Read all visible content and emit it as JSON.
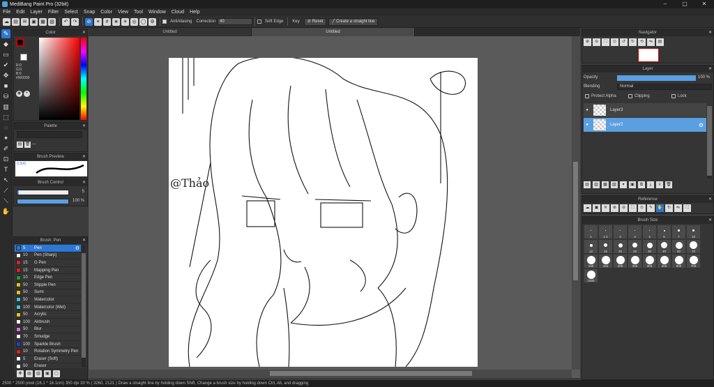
{
  "title": "MediBang Paint Pro (32bit)",
  "menu": [
    "File",
    "Edit",
    "Layer",
    "Filter",
    "Select",
    "Snap",
    "Color",
    "View",
    "Tool",
    "Window",
    "Cloud",
    "Help"
  ],
  "toolbar": {
    "antialias": "AntiAliasing",
    "correction_label": "Correction",
    "correction_value": "40",
    "soft_edge": "Soft Edge",
    "key": "Key",
    "reset": "Reset",
    "straight_line": "Create a straight line"
  },
  "tabs": [
    "Untitled",
    "Untitled"
  ],
  "color_panel": {
    "title": "Color",
    "r": "R:0",
    "g": "G:0",
    "b": "B:0",
    "hex": "#000000"
  },
  "palette_panel": {
    "title": "Palette",
    "dash": "---"
  },
  "brush_preview": {
    "title": "Brush Preview",
    "size": "0.3(4)"
  },
  "brush_control": {
    "title": "Brush Control",
    "size": "5",
    "opacity": "100 %",
    "opacity_fraction": 1.0
  },
  "brush_list": {
    "title": "Brush: Pen",
    "items": [
      {
        "size": "5",
        "name": "Pen",
        "color": "#2b78d6",
        "selected": true
      },
      {
        "size": "10",
        "name": "Pen (Sharp)",
        "color": "#ffffff"
      },
      {
        "size": "15",
        "name": "G Pen",
        "color": "#e02020"
      },
      {
        "size": "15",
        "name": "Mapping Pen",
        "color": "#e02020"
      },
      {
        "size": "10",
        "name": "Edge Pen",
        "color": "#20a020"
      },
      {
        "size": "50",
        "name": "Stipple Pen",
        "color": "#e0c020"
      },
      {
        "size": "50",
        "name": "Sumi",
        "color": "#e0c020"
      },
      {
        "size": "50",
        "name": "Watercolor",
        "color": "#40c0e0"
      },
      {
        "size": "100",
        "name": "Watercolor (Wet)",
        "color": "#40c0e0"
      },
      {
        "size": "50",
        "name": "Acrylic",
        "color": "#e0c020"
      },
      {
        "size": "100",
        "name": "Airbrush",
        "color": "#ffffff"
      },
      {
        "size": "50",
        "name": "Blur",
        "color": "#e070e0"
      },
      {
        "size": "70",
        "name": "Smudge",
        "color": "#ffffff"
      },
      {
        "size": "100",
        "name": "Sparkle Brush",
        "color": "#2040d0"
      },
      {
        "size": "10",
        "name": "Rotation Symmetry Pen",
        "color": "#e02020"
      },
      {
        "size": "5",
        "name": "Eraser (Soft)",
        "color": "#ffffff"
      },
      {
        "size": "50",
        "name": "Eraser",
        "color": "#ffffff"
      }
    ]
  },
  "navigator": {
    "title": "Navigator"
  },
  "layer_panel": {
    "title": "Layer",
    "opacity_label": "Opacity",
    "opacity": "100 %",
    "opacity_fraction": 1.0,
    "blending_label": "Blending",
    "blending": "Normal",
    "protect_alpha": "Protect Alpha",
    "clipping": "Clipping",
    "lock": "Lock",
    "layers": [
      {
        "name": "Layer3",
        "selected": false
      },
      {
        "name": "Layer2",
        "selected": true
      }
    ]
  },
  "reference": {
    "title": "Reference"
  },
  "brush_size": {
    "title": "Brush Size",
    "sizes": [
      "1",
      "1.5",
      "2",
      "3",
      "4",
      "5",
      "7",
      "10",
      "12",
      "15",
      "20",
      "25",
      "30",
      "40",
      "50",
      "70",
      "100",
      "150",
      "200",
      "250",
      "300",
      "400",
      "500",
      "700",
      "1000"
    ]
  },
  "status": "2500 * 2500 pixel  (16.1 * 16.1cm)  350 dpi  33 %  ( 3260, 2121 )  Draw a straight line by holding down Shift, Change a brush size by holding down Ctrl, Alt, and dragging",
  "canvas_signature": "@Thảo"
}
